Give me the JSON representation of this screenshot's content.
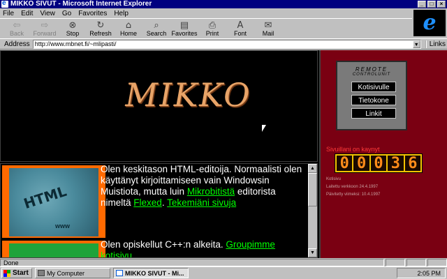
{
  "window": {
    "title": "MIKKO SIVUT - Microsoft Internet Explorer",
    "controls": [
      "_",
      "□",
      "×"
    ]
  },
  "menu": [
    "File",
    "Edit",
    "View",
    "Go",
    "Favorites",
    "Help"
  ],
  "toolbar": [
    {
      "label": "Back",
      "icon": "back-arrow-icon",
      "enabled": false
    },
    {
      "label": "Forward",
      "icon": "forward-arrow-icon",
      "enabled": false
    },
    {
      "label": "Stop",
      "icon": "stop-icon",
      "enabled": true
    },
    {
      "label": "Refresh",
      "icon": "refresh-icon",
      "enabled": true
    },
    {
      "label": "Home",
      "icon": "home-icon",
      "enabled": true
    },
    {
      "label": "Search",
      "icon": "search-icon",
      "enabled": true
    },
    {
      "label": "Favorites",
      "icon": "favorites-icon",
      "enabled": true
    },
    {
      "label": "Print",
      "icon": "print-icon",
      "enabled": true
    },
    {
      "label": "Font",
      "icon": "font-icon",
      "enabled": true
    },
    {
      "label": "Mail",
      "icon": "mail-icon",
      "enabled": true
    }
  ],
  "address": {
    "label": "Address",
    "url": "http://www.mbnet.fi/~mlipasti/",
    "links_label": "Links"
  },
  "page": {
    "logo_text": "MIKKO",
    "image_caption": "HTML",
    "image_sub": "www",
    "para1": {
      "text1": "Olen keskitason HTML-editoija. Normaalisti olen käyttänyt kirjoittamiseen vain Windowsin Muistiota, mutta luin ",
      "link1": "Mikrobitistä",
      "text2": " editorista nimeltä ",
      "link2": "Flexed",
      "text3": ". ",
      "link3": "Tekemiäni sivuja"
    },
    "para2": {
      "text1": "Olen opiskellut C++:n alkeita. ",
      "link1": "Groupimme kotisivu"
    }
  },
  "remote": {
    "title": "REMOTE",
    "subtitle": "CONTROLUNIT",
    "buttons": [
      "Kotisivulle",
      "Tietokone",
      "Linkit"
    ]
  },
  "counter": {
    "label": "Sivuillani on kaynyt",
    "digits": [
      "0",
      "0",
      "0",
      "3",
      "6"
    ],
    "stats": [
      "Kotisivu",
      "Laitettu verkkoon 24.4.1997",
      "Päivitetty viimeksi: 10.4.1997"
    ]
  },
  "status": {
    "text": "Done"
  },
  "taskbar": {
    "start": "Start",
    "tasks": [
      {
        "label": "My Computer",
        "active": false
      },
      {
        "label": "MIKKO SIVUT - Mi...",
        "active": true
      }
    ],
    "clock": "2:05 PM"
  },
  "colors": {
    "title_bar": "#000080",
    "right_frame_bg": "#7a0012",
    "link": "#00ff00",
    "counter_bg": "#f2c200"
  }
}
